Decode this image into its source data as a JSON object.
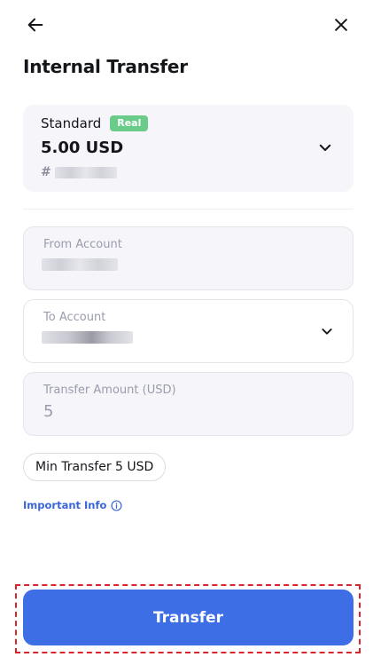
{
  "header": {
    "back_icon": "arrow-left-icon",
    "close_icon": "close-icon",
    "title": "Internal Transfer"
  },
  "account_card": {
    "account_type": "Standard",
    "badge": "Real",
    "balance": "5.00 USD",
    "number_prefix": "#",
    "chevron_icon": "chevron-down-icon"
  },
  "form": {
    "from_account": {
      "label": "From Account"
    },
    "to_account": {
      "label": "To Account",
      "chevron_icon": "chevron-down-icon"
    },
    "amount": {
      "label": "Transfer Amount (USD)",
      "value": "5"
    }
  },
  "min_transfer": "Min Transfer 5 USD",
  "important_info": {
    "label": "Important Info",
    "icon": "info-icon"
  },
  "transfer_button": {
    "label": "Transfer"
  },
  "colors": {
    "accent": "#3d6ee6",
    "badge_green": "#6bcb8a",
    "link_blue": "#3a66d8",
    "highlight_red": "#d9242c"
  }
}
